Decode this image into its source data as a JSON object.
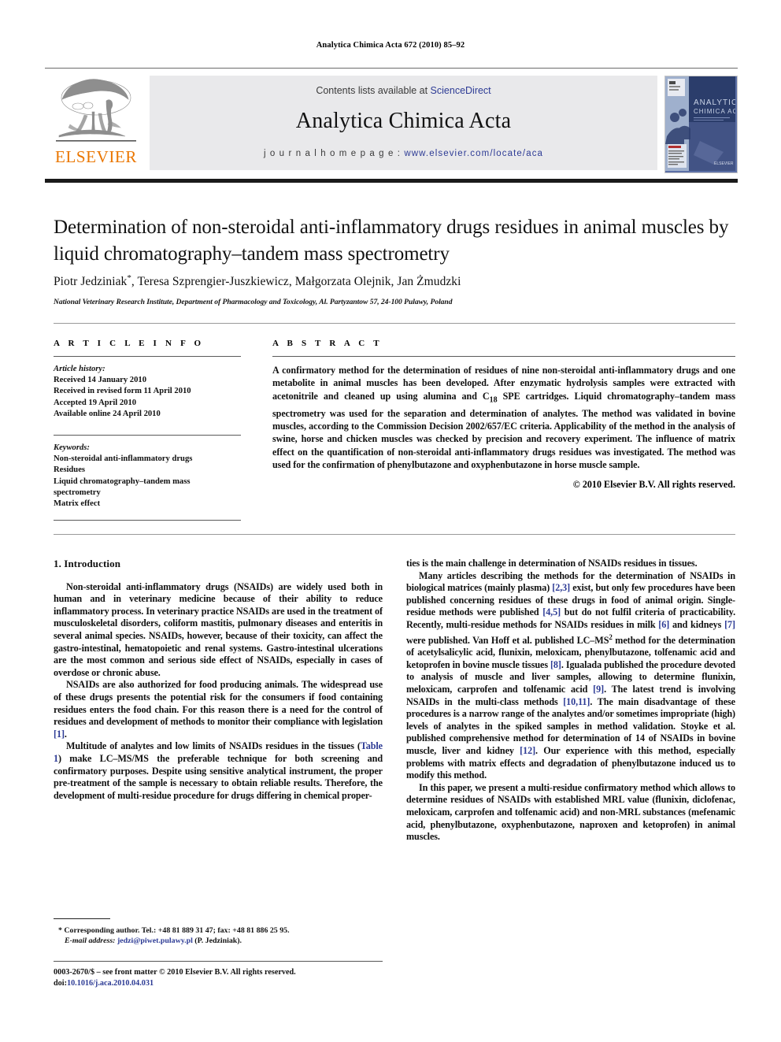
{
  "running_head": "Analytica Chimica Acta 672 (2010) 85–92",
  "masthead": {
    "contents_prefix": "Contents lists available at ",
    "sciencedirect": "ScienceDirect",
    "journal_title": "Analytica Chimica Acta",
    "homepage_label": "j o u r n a l   h o m e p a g e :",
    "homepage_url": "www.elsevier.com/locate/aca",
    "publisher_logo": "ELSEVIER",
    "cover_title_line1": "ANALYTICA",
    "cover_title_line2": "CHIMICA ACTA",
    "accent_orange": "#ea7600",
    "link_blue": "#2d3b95",
    "band_gray": "#e9e9eb"
  },
  "article": {
    "title": "Determination of non-steroidal anti-inflammatory drugs residues in animal muscles by liquid chromatography–tandem mass spectrometry",
    "authors": "Piotr Jedziniak, Teresa Szprengier-Juszkiewicz, Małgorzata Olejnik, Jan Żmudzki",
    "author_marker": "*",
    "affiliation": "National Veterinary Research Institute, Department of Pharmacology and Toxicology, Al. Partyzantow 57, 24-100 Pulawy, Poland"
  },
  "article_info": {
    "heading": "A R T I C L E    I N F O",
    "history_label": "Article history:",
    "history": [
      "Received 14 January 2010",
      "Received in revised form 11 April 2010",
      "Accepted 19 April 2010",
      "Available online 24 April 2010"
    ],
    "keywords_label": "Keywords:",
    "keywords": [
      "Non-steroidal anti-inflammatory drugs",
      "Residues",
      "Liquid chromatography–tandem mass",
      "spectrometry",
      "Matrix effect"
    ]
  },
  "abstract": {
    "heading": "A B S T R A C T",
    "text": "A confirmatory method for the determination of residues of nine non-steroidal anti-inflammatory drugs and one metabolite in animal muscles has been developed. After enzymatic hydrolysis samples were extracted with acetonitrile and cleaned up using alumina and C18 SPE cartridges. Liquid chromatography–tandem mass spectrometry was used for the separation and determination of analytes. The method was validated in bovine muscles, according to the Commission Decision 2002/657/EC criteria. Applicability of the method in the analysis of swine, horse and chicken muscles was checked by precision and recovery experiment. The influence of matrix effect on the quantification of non-steroidal anti-inflammatory drugs residues was investigated. The method was used for the confirmation of phenylbutazone and oxyphenbutazone in horse muscle sample.",
    "rights": "© 2010 Elsevier B.V. All rights reserved."
  },
  "body": {
    "section_number_title": "1.  Introduction",
    "left_paragraphs": [
      "Non-steroidal anti-inflammatory drugs (NSAIDs) are widely used both in human and in veterinary medicine because of their ability to reduce inflammatory process. In veterinary practice NSAIDs are used in the treatment of musculoskeletal disorders, coliform mastitis, pulmonary diseases and enteritis in several animal species. NSAIDs, however, because of their toxicity, can affect the gastro-intestinal, hematopoietic and renal systems. Gastro-intestinal ulcerations are the most common and serious side effect of NSAIDs, especially in cases of overdose or chronic abuse.",
      "NSAIDs are also authorized for food producing animals. The widespread use of these drugs presents the potential risk for the consumers if food containing residues enters the food chain. For this reason there is a need for the control of residues and development of methods to monitor their compliance with legislation [1].",
      "Multitude of analytes and low limits of NSAIDs residues in the tissues (Table 1) make LC–MS/MS the preferable technique for both screening and confirmatory purposes. Despite using sensitive analytical instrument, the proper pre-treatment of the sample is necessary to obtain reliable results. Therefore, the development of multi-residue procedure for drugs differing in chemical proper-"
    ],
    "right_paragraphs": [
      "ties is the main challenge in determination of NSAIDs residues in tissues.",
      "Many articles describing the methods for the determination of NSAIDs in biological matrices (mainly plasma) [2,3] exist, but only few procedures have been published concerning residues of these drugs in food of animal origin. Single-residue methods were published [4,5] but do not fulfil criteria of practicability. Recently, multi-residue methods for NSAIDs residues in milk [6] and kidneys [7] were published. Van Hoff et al. published LC–MS2 method for the determination of acetylsalicylic acid, flunixin, meloxicam, phenylbutazone, tolfenamic acid and ketoprofen in bovine muscle tissues [8]. Igualada published the procedure devoted to analysis of muscle and liver samples, allowing to determine flunixin, meloxicam, carprofen and tolfenamic acid [9]. The latest trend is involving NSAIDs in the multi-class methods [10,11]. The main disadvantage of these procedures is a narrow range of the analytes and/or sometimes impropriate (high) levels of analytes in the spiked samples in method validation. Stoyke et al. published comprehensive method for determination of 14 of NSAIDs in bovine muscle, liver and kidney [12]. Our experience with this method, especially problems with matrix effects and degradation of phenylbutazone induced us to modify this method.",
      "In this paper, we present a multi-residue confirmatory method which allows to determine residues of NSAIDs with established MRL value (flunixin, diclofenac, meloxicam, carprofen and tolfenamic acid) and non-MRL substances (mefenamic acid, phenylbutazone, oxyphenbutazone, naproxen and ketoprofen) in animal muscles."
    ],
    "table_ref": "Table 1"
  },
  "footnote": {
    "corresponding": "* Corresponding author. Tel.: +48 81 889 31 47; fax: +48 81 886 25 95.",
    "email_label": "E-mail address:",
    "email": "jedzi@piwet.pulawy.pl",
    "email_suffix": "(P. Jedziniak)."
  },
  "imprint": {
    "issn_line": "0003-2670/$ – see front matter © 2010 Elsevier B.V. All rights reserved.",
    "doi_label": "doi:",
    "doi": "10.1016/j.aca.2010.04.031"
  }
}
